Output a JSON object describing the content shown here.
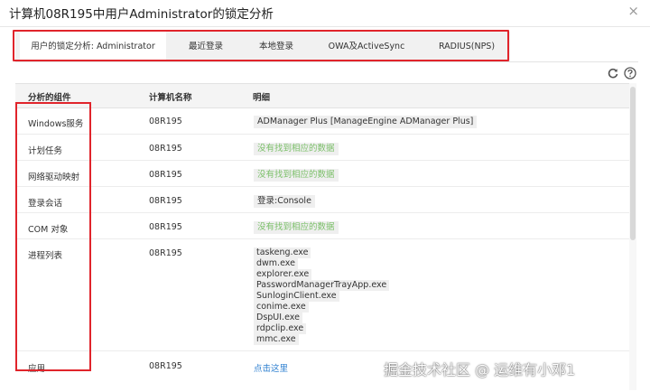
{
  "dialog": {
    "title": "计算机08R195中用户Administrator的锁定分析",
    "close_glyph": "×"
  },
  "tabs": [
    {
      "label": "用户的锁定分析: Administrator",
      "active": true
    },
    {
      "label": "最近登录",
      "active": false
    },
    {
      "label": "本地登录",
      "active": false
    },
    {
      "label": "OWA及ActiveSync",
      "active": false
    },
    {
      "label": "RADIUS(NPS)",
      "active": false
    }
  ],
  "toolbar": {
    "refresh_icon": "refresh-icon",
    "help_icon": "help-icon"
  },
  "table": {
    "headers": [
      "分析的组件",
      "计算机名称",
      "明细"
    ],
    "rows": [
      {
        "component": "Windows服务",
        "computer": "08R195",
        "detail": "ADManager Plus [ManageEngine ADManager Plus]"
      },
      {
        "component": "计划任务",
        "computer": "08R195",
        "detail": "没有找到相应的数据"
      },
      {
        "component": "网络驱动映射",
        "computer": "08R195",
        "detail": "没有找到相应的数据"
      },
      {
        "component": "登录会话",
        "computer": "08R195",
        "detail": "登录:Console"
      },
      {
        "component": "COM 对象",
        "computer": "08R195",
        "detail": "没有找到相应的数据"
      },
      {
        "component": "进程列表",
        "computer": "08R195",
        "processes": [
          "taskeng.exe",
          "dwm.exe",
          "explorer.exe",
          "PasswordManagerTrayApp.exe",
          "SunloginClient.exe",
          "conime.exe",
          "DspUI.exe",
          "rdpclip.exe",
          "mmc.exe"
        ]
      },
      {
        "component": "应用",
        "computer": "08R195",
        "detail": "点击这里"
      }
    ]
  },
  "colors": {
    "highlight": "#e0242b",
    "no_data_text": "#7cc06a",
    "link": "#2d7fd0"
  },
  "watermark": "掘金技术社区 @ 运维有小邓1"
}
